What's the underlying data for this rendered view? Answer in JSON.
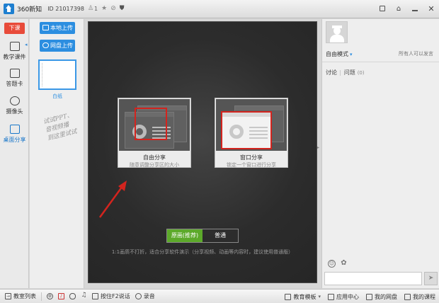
{
  "titlebar": {
    "app_name": "360新知",
    "id_text": "ID  21017398",
    "user_count": "1",
    "icons": [
      "user-icon",
      "star-icon",
      "settings-icon",
      "shield-icon"
    ],
    "controls": [
      "restore-icon",
      "skin-icon",
      "minimize-icon",
      "close-icon"
    ]
  },
  "leftnav": {
    "class_button": "下课",
    "items": [
      {
        "label": "教学课件",
        "icon": "courseware-icon"
      },
      {
        "label": "答题卡",
        "icon": "answer-card-icon"
      },
      {
        "label": "摄像头",
        "icon": "camera-icon"
      },
      {
        "label": "桌面分享",
        "icon": "desktop-share-icon",
        "active": true
      }
    ]
  },
  "material": {
    "local_upload": "本地上传",
    "cloud_upload": "网盘上传",
    "whiteboard_label": "白纸",
    "hand_note_lines": [
      "试试PPT、",
      "音视频播",
      "到这里试试"
    ]
  },
  "stage": {
    "cards": [
      {
        "title": "自由分享",
        "subtitle": "随意调整分享区的大小"
      },
      {
        "title": "窗口分享",
        "subtitle": "锁定一个窗口进行分享"
      }
    ],
    "toggle": {
      "on": "原画(推荐)",
      "off": "普通"
    },
    "hint": "1:1画质不打折，适合分享软件演示（分享视频、动画等内容时，建议使用普通版）"
  },
  "rightpanel": {
    "mode": "自由模式",
    "speak_note": "所有人可以发言",
    "tab_discussion": "讨论",
    "tab_question": "问题",
    "question_count": "(0)"
  },
  "statusbar": {
    "classroom_list": "教室列表",
    "f2_text": "按住F2说话",
    "record": "录音",
    "edu_template": "教育模板",
    "app_center": "应用中心",
    "my_disk": "我的网盘",
    "my_courses": "我的课程"
  },
  "colors": {
    "accent_blue": "#2c8ee0",
    "class_red": "#e84b3a",
    "toggle_green": "#5ca92a",
    "frame_red": "#d3241e"
  }
}
